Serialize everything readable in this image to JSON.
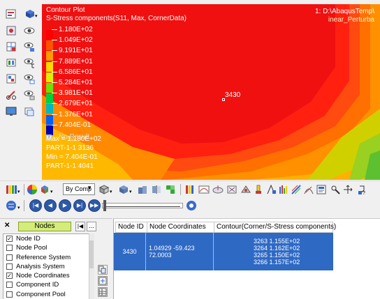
{
  "viewport": {
    "title": "Contour Plot",
    "subtitle": "S-Stress components(S11, Max, CornerData)",
    "path_line1": "1: D:\\AbaqusTemp\\",
    "path_line2": "inear_Perturba",
    "node_label": "3430",
    "legend": [
      {
        "label": "1.180E+02",
        "color": "#ff0000"
      },
      {
        "label": "1.049E+02",
        "color": "#ff5200"
      },
      {
        "label": "9.191E+01",
        "color": "#ff9a00"
      },
      {
        "label": "7.889E+01",
        "color": "#ffd800"
      },
      {
        "label": "6.586E+01",
        "color": "#dcf000"
      },
      {
        "label": "5.284E+01",
        "color": "#70e000"
      },
      {
        "label": "3.981E+01",
        "color": "#00d040"
      },
      {
        "label": "2.679E+01",
        "color": "#00b8c0"
      },
      {
        "label": "1.376E+01",
        "color": "#0060ff"
      },
      {
        "label": "7.404E-01",
        "color": "#0000b0"
      }
    ],
    "no_result": "No Result",
    "no_result_color": "#c0c0c0",
    "stats": [
      "Max = 1.180E+02",
      "PART-1-1 3136",
      "Min = 7.404E-01",
      "PART-1-1 4041"
    ]
  },
  "toolbar": {
    "color_mode": "By Comp"
  },
  "panel": {
    "tab_label": "Nodes",
    "prev_label": "|◀",
    "more_label": "...",
    "close_label": "✕",
    "items": [
      {
        "label": "Node ID",
        "checked": true
      },
      {
        "label": "Node Pool",
        "checked": false
      },
      {
        "label": "Reference System",
        "checked": false
      },
      {
        "label": "Analysis System",
        "checked": false
      },
      {
        "label": "Node Coordinates",
        "checked": true
      },
      {
        "label": "Component ID",
        "checked": false
      },
      {
        "label": "Component Pool",
        "checked": false
      }
    ]
  },
  "table": {
    "headers": [
      "Node ID",
      "Node Coordinates",
      "Contour(Corner/S-Stress components)"
    ],
    "row": {
      "node_id": "3430",
      "coords": "1.04929 -59.423 72.0003",
      "contour": [
        "3263  1.155E+02",
        "3264  1.162E+02",
        "3265  1.150E+02",
        "3266  1.157E+02"
      ]
    }
  },
  "colors": {
    "selection": "#2e69c4",
    "panel_tab": "#d4ec7a"
  }
}
